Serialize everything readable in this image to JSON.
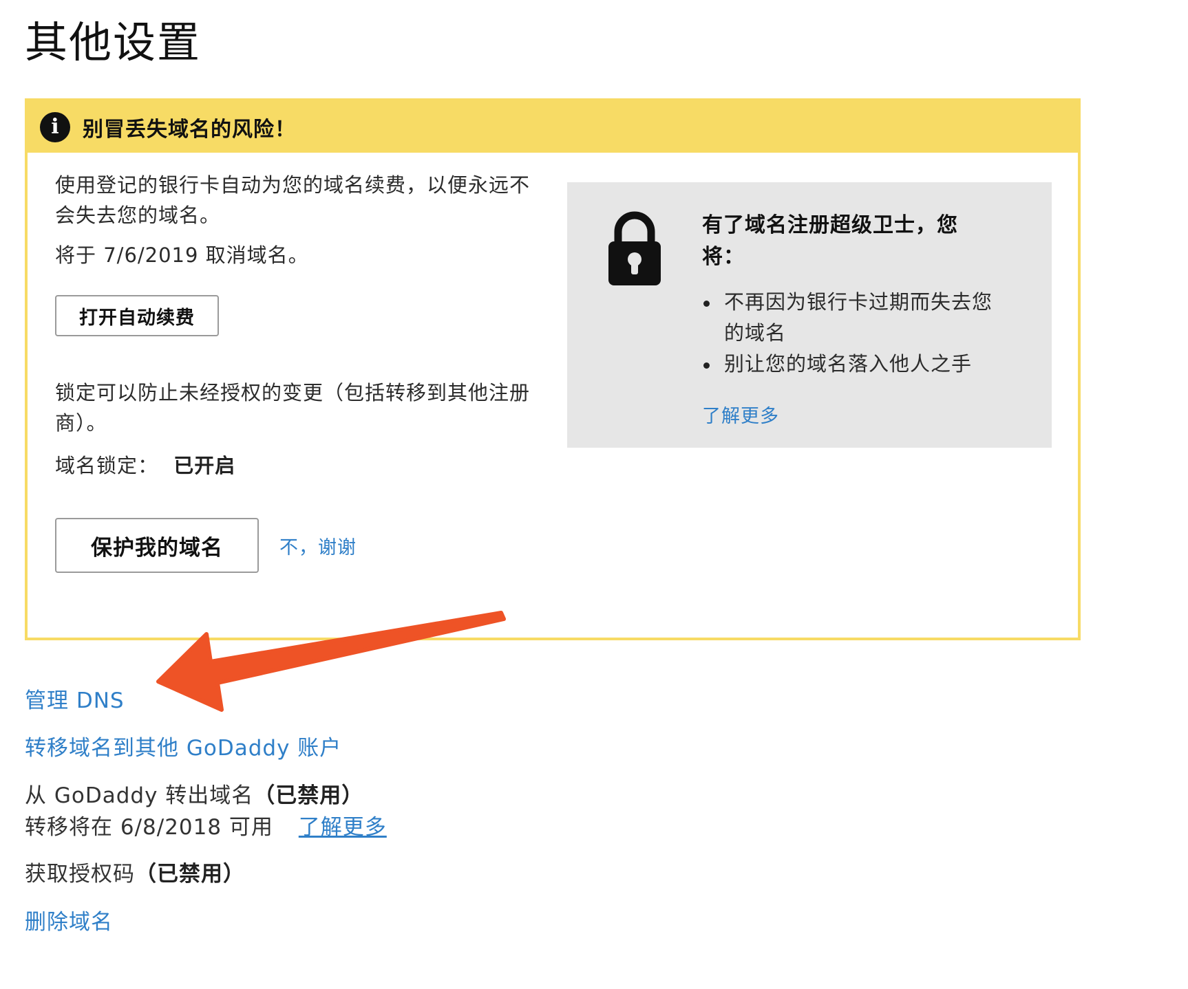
{
  "page_title": "其他设置",
  "warning": {
    "title": "别冒丢失域名的风险！",
    "icon": "info-icon",
    "auto_renew_text": "使用登记的银行卡自动为您的域名续费，以便永远不会失去您的域名。",
    "cancel_text": "将于 7/6/2019 取消域名。",
    "auto_renew_button": "打开自动续费",
    "lock_text": "锁定可以防止未经授权的变更（包括转移到其他注册商）。",
    "lock_label": "域名锁定：",
    "lock_status": "已开启",
    "protect_button": "保护我的域名",
    "no_thanks": "不，谢谢"
  },
  "guard_panel": {
    "icon": "lock-icon",
    "title": "有了域名注册超级卫士，您将：",
    "benefits": [
      "不再因为银行卡过期而失去您的域名",
      "别让您的域名落入他人之手"
    ],
    "learn_more": "了解更多"
  },
  "links": {
    "manage_dns": "管理 DNS",
    "transfer_account": "转移域名到其他 GoDaddy 账户",
    "transfer_out": "从 GoDaddy 转出域名",
    "transfer_out_status": "（已禁用）",
    "transfer_available": "转移将在 6/8/2018 可用",
    "transfer_learn_more": "了解更多",
    "auth_code": "获取授权码",
    "auth_code_status": "（已禁用）",
    "delete_domain": "删除域名"
  },
  "colors": {
    "warning_yellow": "#f7db65",
    "link_blue": "#2f7fc8",
    "panel_gray": "#e6e6e6",
    "annotation_arrow": "#ee5326"
  }
}
